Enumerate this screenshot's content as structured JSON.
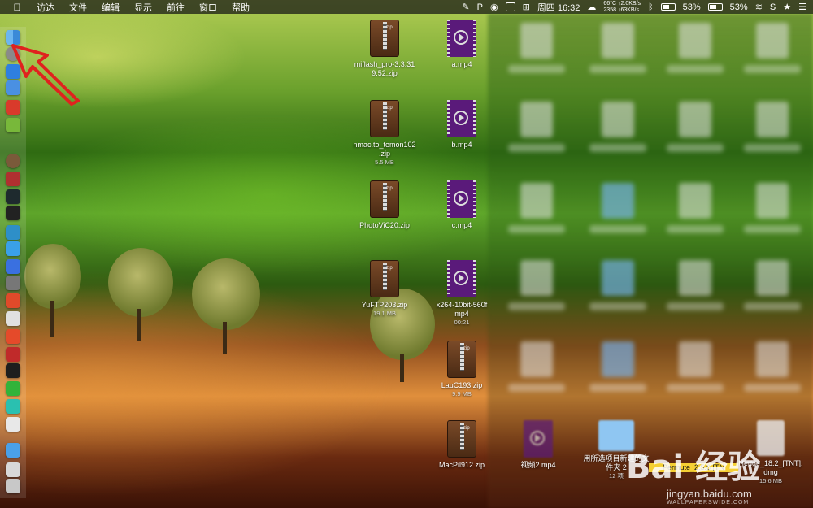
{
  "menubar": {
    "items": [
      "访达",
      "文件",
      "编辑",
      "显示",
      "前往",
      "窗口",
      "帮助"
    ],
    "clock": "周四 16:32",
    "net_temp": "66°C",
    "net_up": "↑2.0KB/s",
    "net_num": "2358",
    "net_down": "↓63KB/s",
    "battery_pct_1": "53%",
    "battery_pct_2": "53%"
  },
  "dock": {
    "colors": [
      "#3d8fe0",
      "#8a8a8a",
      "#2f7fe0",
      "#4a90e2",
      "#d93a2b",
      "#78b83a",
      "#7a5a3a",
      "#b03030",
      "#1e2a2e",
      "#222",
      "#2e8fc8",
      "#3aa0e8",
      "#3a70e0",
      "#777",
      "#e04a2a",
      "#e0e0e0",
      "#e54a2a",
      "#c02a2a",
      "#1e1e1e",
      "#32b33a",
      "#2ac0b0",
      "#e8e8e8",
      "#4aa0e8",
      "#d8d8d8",
      "#c8c8c8"
    ]
  },
  "files": [
    {
      "name": "miflash_pro-3.3.31\n9.52.zip",
      "meta": "",
      "type": "zip"
    },
    {
      "name": "a.mp4",
      "meta": "",
      "type": "mp4"
    },
    {
      "name": "nmac.to_temon102\n.zip",
      "meta": "5.5 MB",
      "type": "zip"
    },
    {
      "name": "b.mp4",
      "meta": "",
      "type": "mp4"
    },
    {
      "name": "PhotoViC20.zip",
      "meta": "",
      "type": "zip"
    },
    {
      "name": "c.mp4",
      "meta": "",
      "type": "mp4"
    },
    {
      "name": "YuFTP203.zip",
      "meta": "19.1 MB",
      "type": "zip"
    },
    {
      "name": "x264-10bit-560f\nmp4",
      "meta": "00:21",
      "type": "mp4"
    },
    {
      "name": "LauC193.zip",
      "meta": "9.9 MB",
      "type": "zip"
    },
    {
      "name": "MacPil912.zip",
      "meta": "",
      "type": "zip"
    }
  ],
  "bottom_row": [
    {
      "name": "视频2.mp4",
      "meta": ""
    },
    {
      "name": "用所选项目新建的文\n件夹 2",
      "meta": "12 项"
    },
    {
      "name": "Permute_2.5.6 [TN",
      "meta": ""
    },
    {
      "name": "Hedge_18.2_[TNT].\ndmg",
      "meta": "15.6 MB"
    }
  ],
  "watermark": {
    "brand": "Bai 经验",
    "url": "jingyan.baidu.com"
  },
  "footer": "WALLPAPERSWIDE.COM",
  "accent": "#e0221e"
}
